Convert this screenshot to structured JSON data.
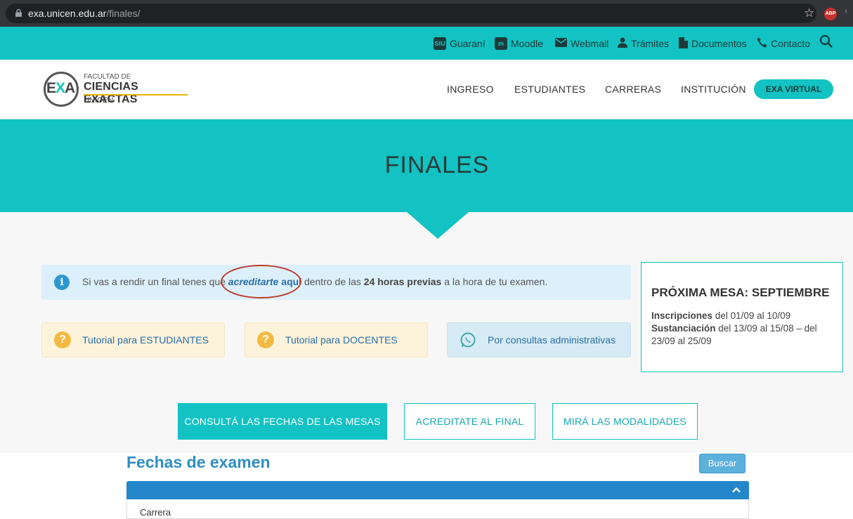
{
  "browser": {
    "url_domain": "exa.unicen.edu.ar",
    "url_path": "/finales/",
    "extension_label": "ABP"
  },
  "topbar": {
    "links": [
      {
        "label": "Guaraní",
        "icon": "siu-icon",
        "icon_text": "SIU"
      },
      {
        "label": "Moodle",
        "icon": "moodle-icon",
        "icon_text": "m"
      },
      {
        "label": "Webmail",
        "icon": "mail-icon"
      },
      {
        "label": "Trámites",
        "icon": "person-icon"
      },
      {
        "label": "Documentos",
        "icon": "document-icon"
      },
      {
        "label": "Contacto",
        "icon": "phone-icon"
      }
    ]
  },
  "header": {
    "logo": {
      "mark": "EXA",
      "line1": "FACULTAD DE",
      "line2": "CIENCIAS EXACTAS",
      "line3": "UNICEN"
    },
    "nav": [
      "INGRESO",
      "ESTUDIANTES",
      "CARRERAS",
      "INSTITUCIÓN"
    ],
    "cta": "EXA VIRTUAL"
  },
  "hero": {
    "title": "FINALES"
  },
  "info": {
    "before": "Si vas a rendir un final tenes que ",
    "link_italic": "acreditarte",
    "link_plain": " aquí",
    "middle": " dentro de las ",
    "bold": "24 horas previas",
    "after": " a la hora de tu examen."
  },
  "cards": [
    {
      "label": "Tutorial para ESTUDIANTES",
      "icon": "question-icon"
    },
    {
      "label": "Tutorial para DOCENTES",
      "icon": "question-icon"
    },
    {
      "label": "Por consultas administrativas",
      "icon": "whatsapp-icon"
    }
  ],
  "proxima": {
    "title": "PRÓXIMA MESA: SEPTIEMBRE",
    "inscripciones_label": "Inscripciones",
    "inscripciones_text": " del 01/09 al 10/09",
    "sustanciacion_label": "Sustanciación",
    "sustanciacion_text": " del 13/09 al 15/08 – del 23/09 al 25/09"
  },
  "actions": [
    {
      "label": "CONSULTÁ LAS FECHAS DE LAS MESAS",
      "active": true
    },
    {
      "label": "ACREDITATE AL FINAL",
      "active": false
    },
    {
      "label": "MIRÁ LAS MODALIDADES",
      "active": false
    }
  ],
  "exam_section": {
    "title": "Fechas de examen",
    "search_button": "Buscar",
    "field_label": "Carrera"
  },
  "colors": {
    "accent": "#13c2c2",
    "link": "#2b6ea8",
    "panel": "#2387c9",
    "annotation": "#c0392b"
  }
}
